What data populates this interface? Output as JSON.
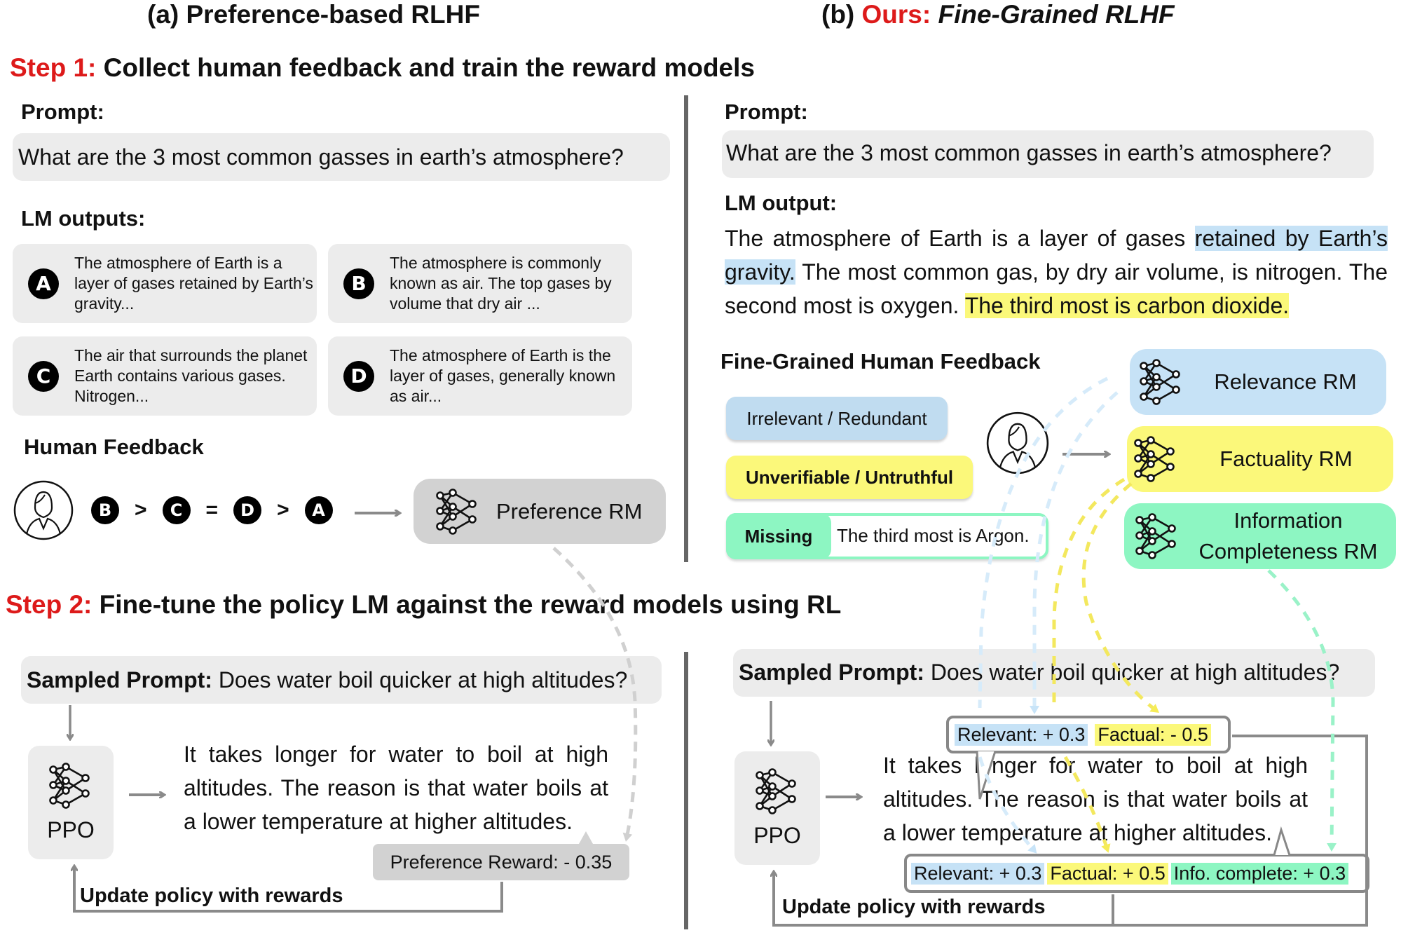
{
  "panel_a": {
    "title": "(a) Preference-based RLHF"
  },
  "panel_b": {
    "title_prefix": "(b) ",
    "title_ours": "Ours:",
    "title_rest": " Fine-Grained RLHF"
  },
  "step1": {
    "label": "Step 1:",
    "text": " Collect human feedback and train the reward models"
  },
  "step2": {
    "label": "Step 2:",
    "text": " Fine-tune the policy LM against the reward models using RL"
  },
  "left_step1": {
    "prompt_heading": "Prompt:",
    "prompt_text": "What are the 3 most common gasses in earth’s atmosphere?",
    "outputs_heading": "LM outputs:",
    "outputs": [
      {
        "letter": "A",
        "text": "The atmosphere of Earth is a layer of gases retained by Earth’s gravity..."
      },
      {
        "letter": "B",
        "text": "The atmosphere is commonly known as air. The top gases by volume that dry air ..."
      },
      {
        "letter": "C",
        "text": "The air that surrounds the planet Earth contains various gases. Nitrogen..."
      },
      {
        "letter": "D",
        "text": "The atmosphere of Earth is the layer of gases, generally known as air..."
      }
    ],
    "feedback_heading": "Human Feedback",
    "ranking": [
      {
        "letter": "B"
      },
      {
        "op": ">"
      },
      {
        "letter": "C"
      },
      {
        "op": "="
      },
      {
        "letter": "D"
      },
      {
        "op": ">"
      },
      {
        "letter": "A"
      }
    ],
    "rm_label": "Preference RM"
  },
  "right_step1": {
    "prompt_heading": "Prompt:",
    "prompt_text": "What are the 3 most common gasses in earth’s atmosphere?",
    "output_heading": "LM output:",
    "output_segments": [
      {
        "text": "The atmosphere of Earth is a layer of gases ",
        "highlight": "none"
      },
      {
        "text": "retained by Earth’s gravity.",
        "highlight": "blue"
      },
      {
        "text": " The most common gas, by dry air volume, is nitrogen. The second most is oxygen. ",
        "highlight": "none"
      },
      {
        "text": "The third most is carbon dioxide.",
        "highlight": "yellow"
      }
    ],
    "feedback_heading": "Fine-Grained Human Feedback",
    "categories": [
      {
        "label": "Irrelevant / Redundant",
        "color": "#c0dcf0"
      },
      {
        "label": "Unverifiable / Untruthful",
        "color": "#fbf87a"
      },
      {
        "label": "Missing",
        "color": "#8df6c2",
        "note": "The third most is Argon."
      }
    ],
    "reward_models": [
      {
        "label": "Relevance RM",
        "color": "#c6e2f6"
      },
      {
        "label": "Factuality RM",
        "color": "#fbf87a"
      },
      {
        "label_line1": "Information",
        "label_line2": "Completeness RM",
        "color": "#8df6c2"
      }
    ]
  },
  "left_step2": {
    "sampled_prompt_label": "Sampled Prompt:",
    "sampled_prompt_text": " Does water boil quicker at high altitudes?",
    "ppo_label": "PPO",
    "generation": "It takes longer for water to boil at high altitudes. The reason is that water boils at a lower temperature at higher altitudes.",
    "reward_label": "Preference Reward: - 0.35",
    "update_label": "Update policy with rewards"
  },
  "right_step2": {
    "sampled_prompt_label": "Sampled Prompt:",
    "sampled_prompt_text": " Does water boil quicker at high altitudes?",
    "ppo_label": "PPO",
    "generation": "It takes longer for water to boil at high altitudes. The reason is that water boils at a lower temperature at higher altitudes.",
    "reward_1": [
      {
        "text": "Relevant: + 0.3",
        "color": "#c0dcf0"
      },
      {
        "text": "Factual: - 0.5",
        "color": "#fbf87a"
      }
    ],
    "reward_2": [
      {
        "text": "Relevant: + 0.3",
        "color": "#c0dcf0"
      },
      {
        "text": "Factual: + 0.5",
        "color": "#fbf87a"
      },
      {
        "text": "Info. complete: + 0.3",
        "color": "#8df6c2"
      }
    ],
    "update_label": "Update policy with rewards"
  },
  "colors": {
    "accent_red": "#dd1a1a",
    "relevance_blue": "#c6e2f6",
    "factuality_yellow": "#fbf87a",
    "completeness_green": "#8df6c2",
    "preference_gray": "#d2d2d2",
    "arrow_gray": "#8a8a8a"
  }
}
